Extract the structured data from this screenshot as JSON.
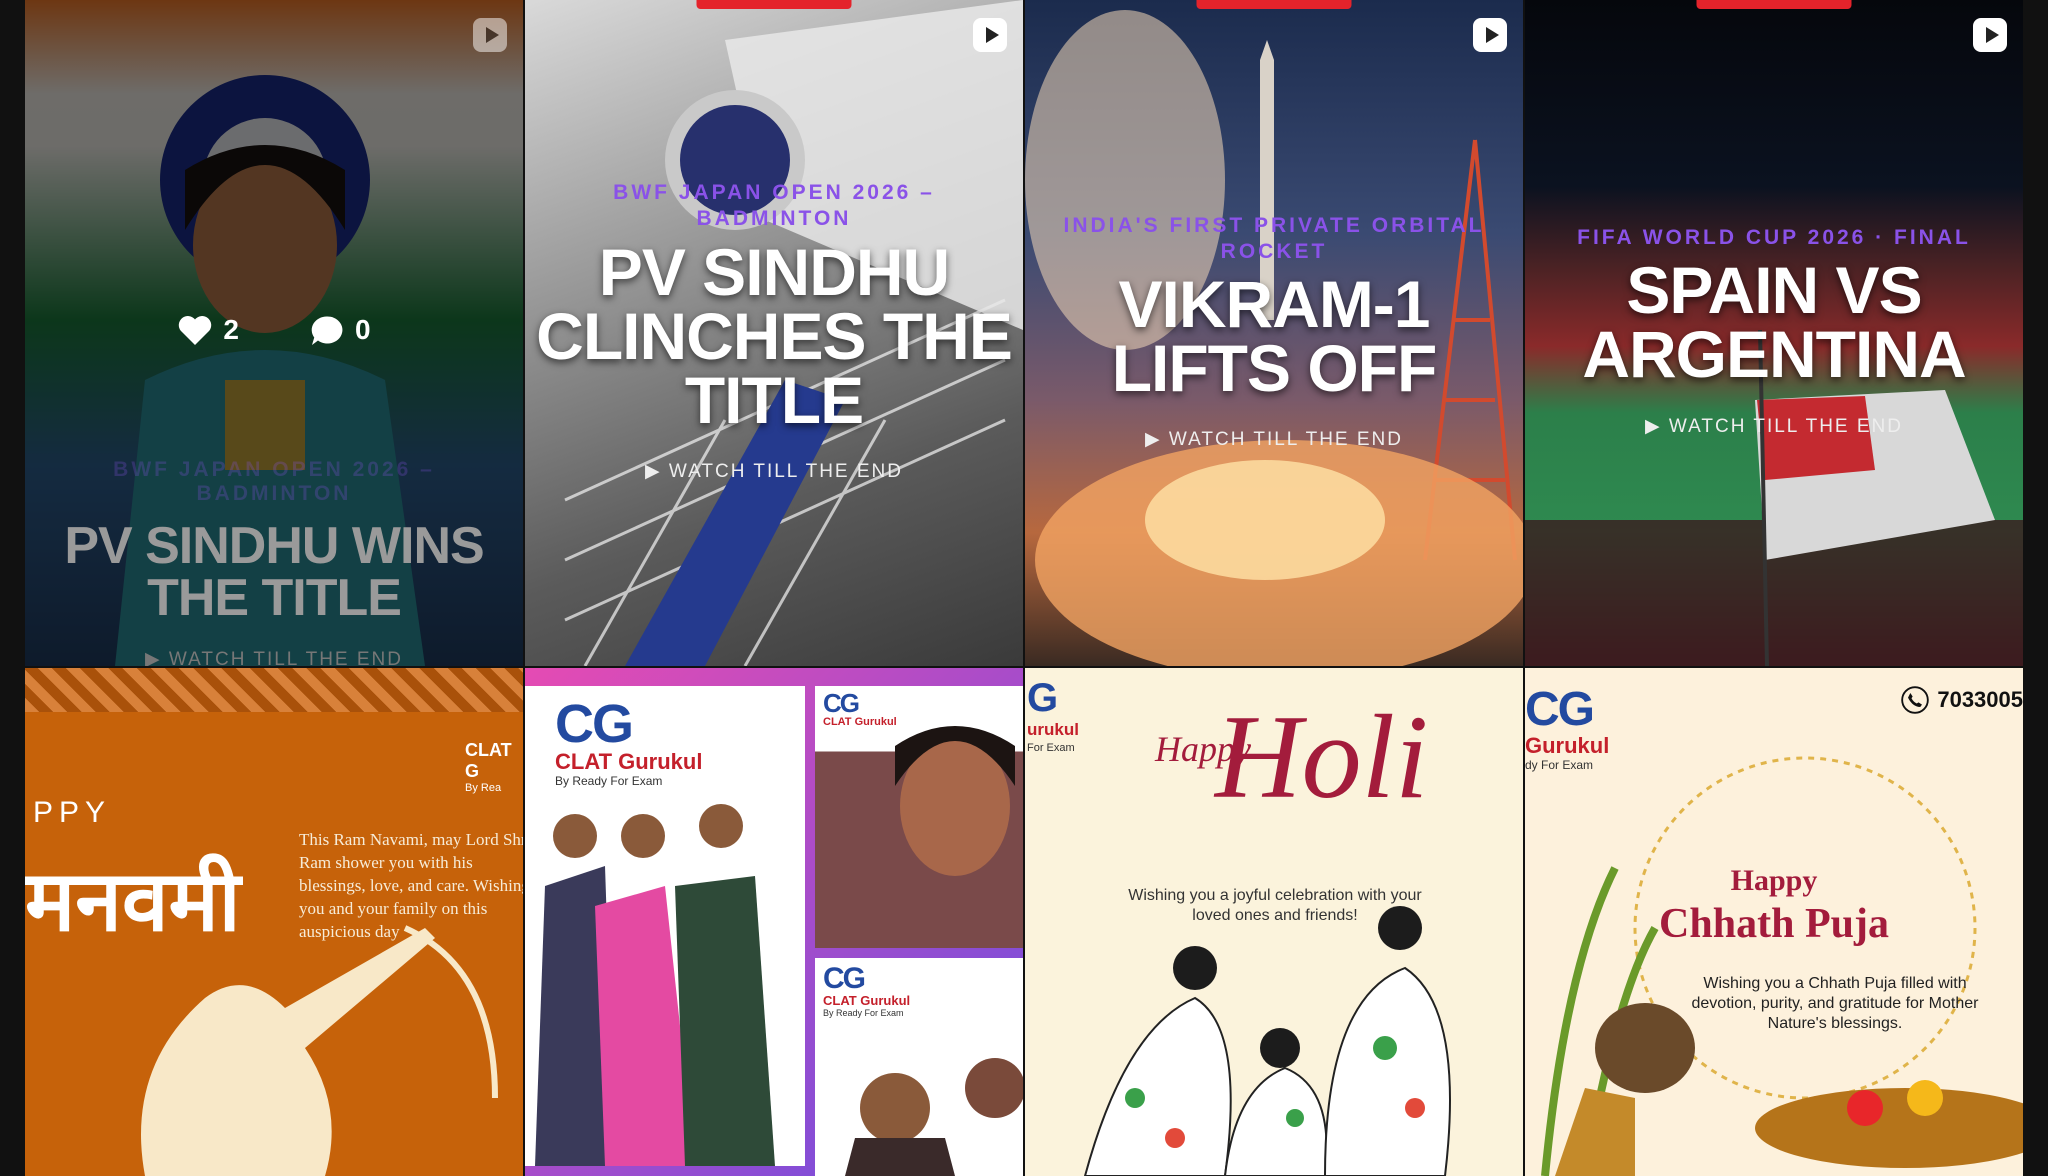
{
  "tiles": [
    {
      "kicker": "BWF Japan Open 2026 – Badminton",
      "headline": "PV SINDHU WINS THE TITLE",
      "watch": "WATCH TILL THE END",
      "likes": "2",
      "comments": "0"
    },
    {
      "kicker": "BWF Japan Open 2026 – Badminton",
      "headline": "PV SINDHU CLINCHES THE TITLE",
      "watch": "WATCH TILL THE END"
    },
    {
      "kicker": "India's First Private Orbital Rocket",
      "headline": "VIKRAM-1 LIFTS OFF",
      "watch": "WATCH TILL THE END"
    },
    {
      "kicker": "FIFA World Cup 2026 · Final",
      "headline": "SPAIN VS ARGENTINA",
      "watch": "WATCH TILL THE END"
    },
    {
      "title_latin": "PPY",
      "title_devanagari": "मनवमी",
      "body": "This Ram Navami, may Lord Shri Ram shower you with his blessings, love, and care. Wishing you and your family on this auspicious day",
      "brand": "CLAT G",
      "by": "By Rea"
    },
    {
      "brand_mark": "CG",
      "brand_name": "CLAT Gurukul",
      "by": "By Ready For Exam"
    },
    {
      "greeting_small": "Happy",
      "greeting_big": "Holi",
      "body": "Wishing you a joyful celebration with your loved ones and friends!",
      "brand_mark": "G",
      "brand_name": "urukul",
      "by": "For Exam"
    },
    {
      "phone": "7033005",
      "greeting_small": "Happy",
      "greeting_big": "Chhath Puja",
      "body": "Wishing you a Chhath Puja filled with devotion, purity, and gratitude for Mother Nature's blessings.",
      "brand_mark": "CG",
      "brand_name": "Gurukul",
      "by": "dy For Exam"
    }
  ],
  "colors": {
    "accent_red": "#e4232b",
    "kicker_purple": "#8a52e8",
    "brand_blue": "#234aa0",
    "brand_red": "#c4202b"
  },
  "icons": [
    "reel-icon",
    "heart-icon",
    "comment-icon",
    "phone-icon",
    "play-icon"
  ]
}
